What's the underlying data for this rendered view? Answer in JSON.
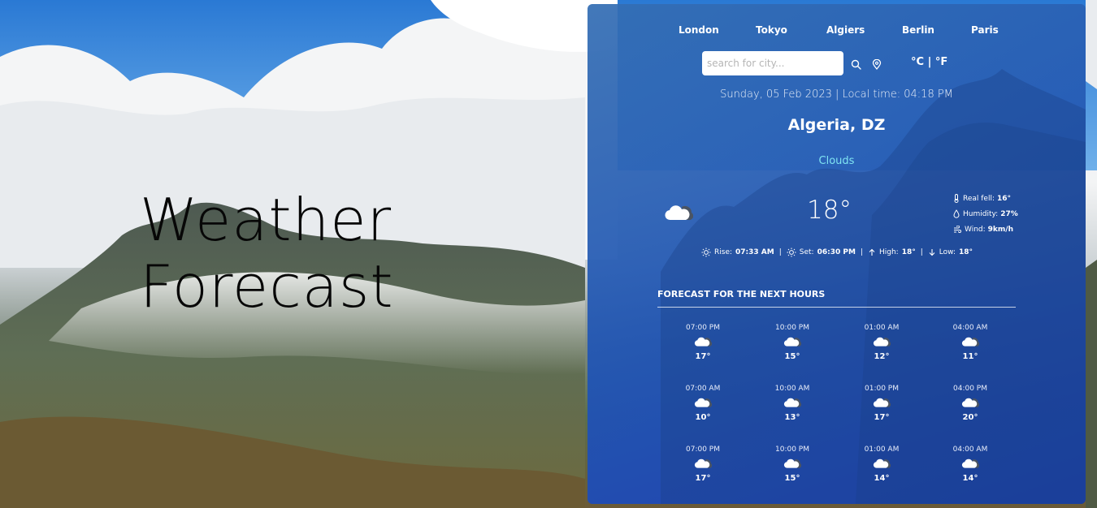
{
  "hero": {
    "title_line1": "Weather",
    "title_line2": "Forecast"
  },
  "cities": [
    "London",
    "Tokyo",
    "Algiers",
    "Berlin",
    "Paris"
  ],
  "search": {
    "placeholder": "search for city...",
    "value": ""
  },
  "units": {
    "celsius": "°C",
    "separator": "|",
    "fahrenheit": "°F"
  },
  "current": {
    "date_time": "Sunday, 05 Feb 2023 | Local time: 04:18 PM",
    "location": "Algeria, DZ",
    "condition": "Clouds",
    "temperature": "18°",
    "real_feel_label": "Real fell:",
    "real_feel": "16°",
    "humidity_label": "Humidity:",
    "humidity": "27%",
    "wind_label": "Wind:",
    "wind": "9km/h",
    "rise_label": "Rise:",
    "rise": "07:33 AM",
    "set_label": "Set:",
    "set": "06:30 PM",
    "high_label": "High:",
    "high": "18°",
    "low_label": "Low:",
    "low": "18°",
    "icon": "cloud-icon"
  },
  "forecast": {
    "title": "FORECAST FOR THE NEXT HOURS",
    "rows": [
      [
        {
          "time": "07:00 PM",
          "temp": "17°",
          "icon": "cloud-icon"
        },
        {
          "time": "10:00 PM",
          "temp": "15°",
          "icon": "cloud-icon"
        },
        {
          "time": "01:00 AM",
          "temp": "12°",
          "icon": "cloud-icon"
        },
        {
          "time": "04:00 AM",
          "temp": "11°",
          "icon": "cloud-icon"
        }
      ],
      [
        {
          "time": "07:00 AM",
          "temp": "10°",
          "icon": "cloud-icon"
        },
        {
          "time": "10:00 AM",
          "temp": "13°",
          "icon": "cloud-icon"
        },
        {
          "time": "01:00 PM",
          "temp": "17°",
          "icon": "cloud-icon"
        },
        {
          "time": "04:00 PM",
          "temp": "20°",
          "icon": "cloud-icon"
        }
      ],
      [
        {
          "time": "07:00 PM",
          "temp": "17°",
          "icon": "cloud-icon"
        },
        {
          "time": "10:00 PM",
          "temp": "15°",
          "icon": "cloud-icon"
        },
        {
          "time": "01:00 AM",
          "temp": "14°",
          "icon": "cloud-icon"
        },
        {
          "time": "04:00 AM",
          "temp": "14°",
          "icon": "cloud-icon"
        }
      ]
    ]
  },
  "colors": {
    "panel": "#2454b4",
    "condition": "#7fe4f2",
    "hero_text": "#070707"
  }
}
